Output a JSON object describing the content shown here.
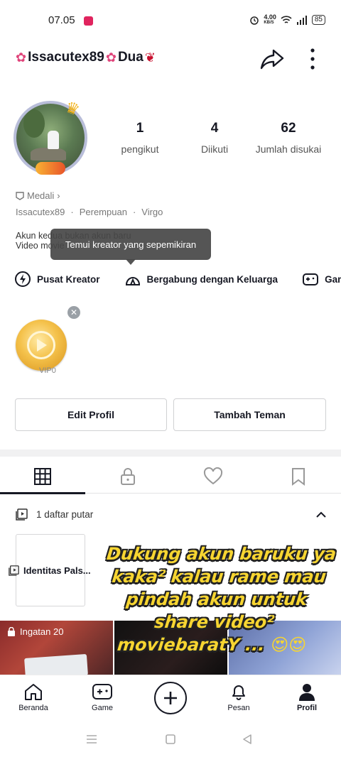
{
  "status_bar": {
    "time": "07.05",
    "speed": "4.00",
    "speed_unit": "KB/S",
    "battery": "85"
  },
  "header": {
    "username": "Issacutex89",
    "title_suffix": "Dua"
  },
  "stats": [
    {
      "value": "1",
      "label": "pengikut"
    },
    {
      "value": "4",
      "label": "Diikuti"
    },
    {
      "value": "62",
      "label": "Jumlah disukai"
    }
  ],
  "profile": {
    "medal": "Medali",
    "handle": "Issacutex89",
    "gender": "Perempuan",
    "zodiac": "Virgo",
    "bio_line1": "Akun kedua bukan akun baru",
    "bio_line2": "Video movie"
  },
  "tooltip": "Temui kreator yang sepemikiran",
  "quick_actions": [
    "Pusat Kreator",
    "Bergabung dengan Keluarga",
    "Game"
  ],
  "vip_label": "VIP0",
  "buttons": {
    "edit": "Edit Profil",
    "add_friend": "Tambah Teman"
  },
  "playlist": {
    "header": "1 daftar putar",
    "card_title": "Identitas Pals..."
  },
  "caption": "Dukung akun baruku ya kaka² kalau rame mau pindah akun untuk share video² moviebaratY ...",
  "caption_emoji": "😍😍",
  "thumbnails": [
    {
      "label": "Ingatan 20"
    },
    {
      "label": ""
    },
    {
      "label": ""
    }
  ],
  "bottom_nav": [
    {
      "label": "Beranda",
      "icon": "home-icon"
    },
    {
      "label": "Game",
      "icon": "gamepad-icon"
    },
    {
      "label": "",
      "icon": "plus-icon"
    },
    {
      "label": "Pesan",
      "icon": "bell-icon"
    },
    {
      "label": "Profil",
      "icon": "person-icon"
    }
  ]
}
